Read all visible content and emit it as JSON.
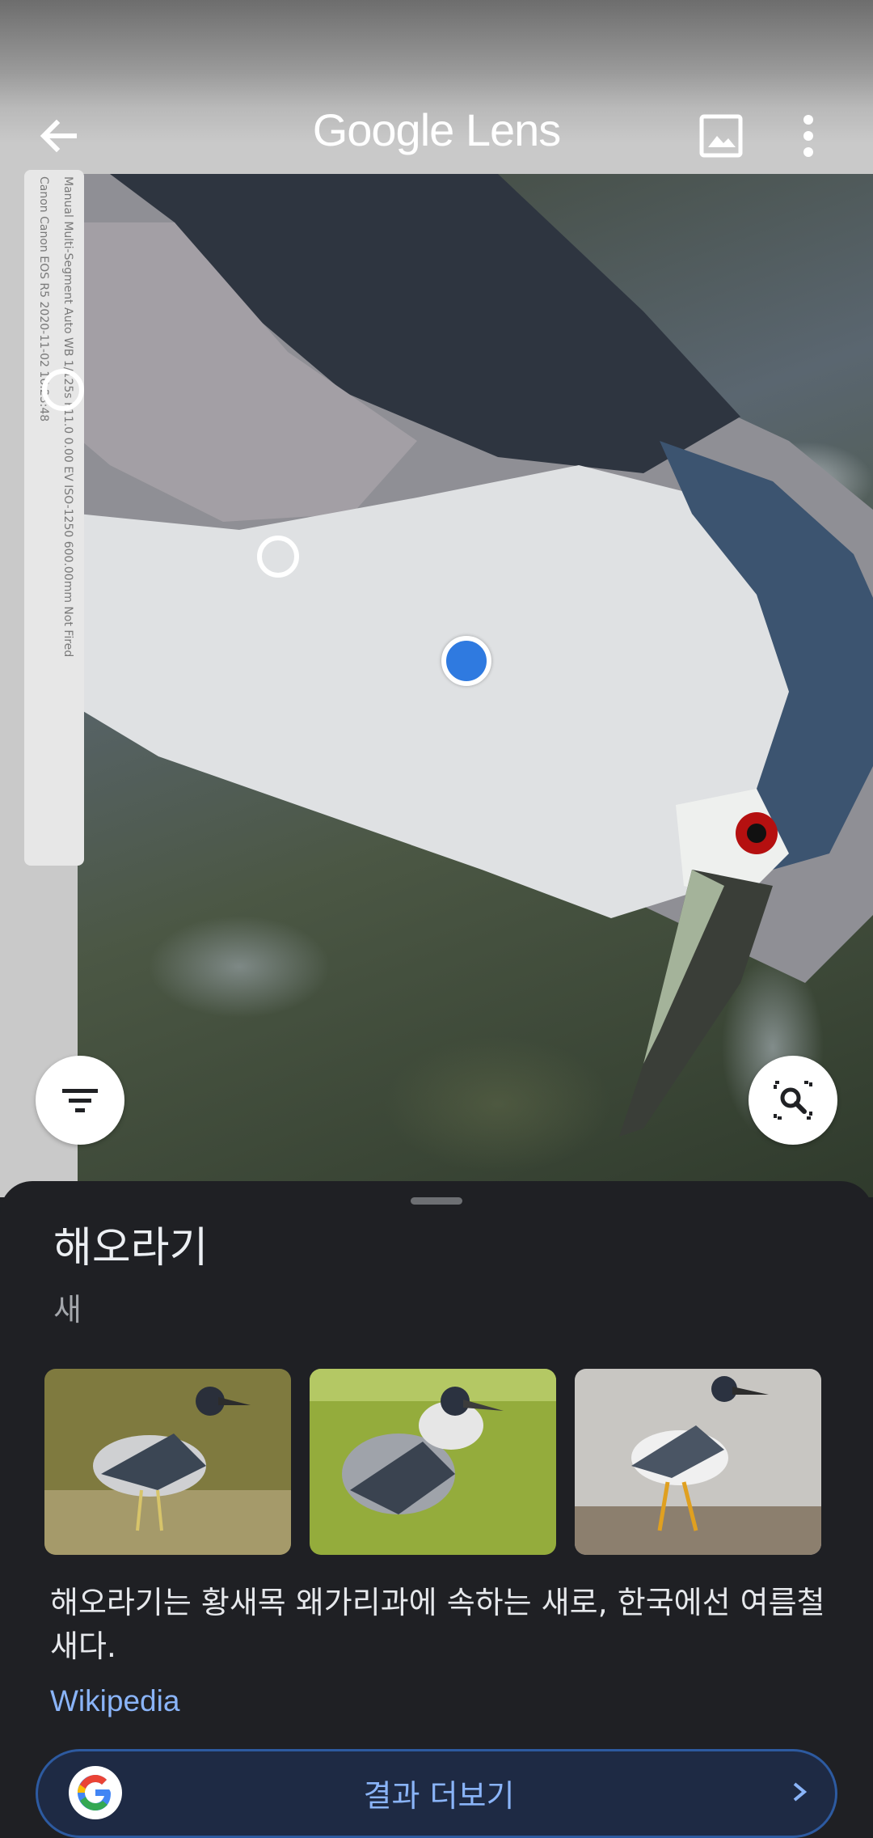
{
  "header": {
    "title": "Google Lens"
  },
  "exif": {
    "line1": "Canon   Canon EOS R5   2020-11-02 16:23:48",
    "line2": "Manual   Multi-Segment   Auto   WB   1/125s   F11.0   0.00 EV   ISO-1250   600.00mm   Not Fired"
  },
  "result": {
    "title": "해오라기",
    "subtitle": "새",
    "description": "해오라기는 황새목 왜가리과에 속하는 새로, 한국에선 여름철새다.",
    "source_link": "Wikipedia",
    "more_button_label": "결과 더보기"
  },
  "colors": {
    "accent": "#8ab4f8",
    "sheet_background": "#1f2024",
    "selected_dot": "#2f7ae0"
  },
  "icons": {
    "back": "arrow-left-icon",
    "gallery": "image-icon",
    "more": "more-vert-icon",
    "filter": "filter-list-icon",
    "search_region": "image-search-icon",
    "google": "google-g-icon",
    "chevron": "chevron-right-icon"
  }
}
